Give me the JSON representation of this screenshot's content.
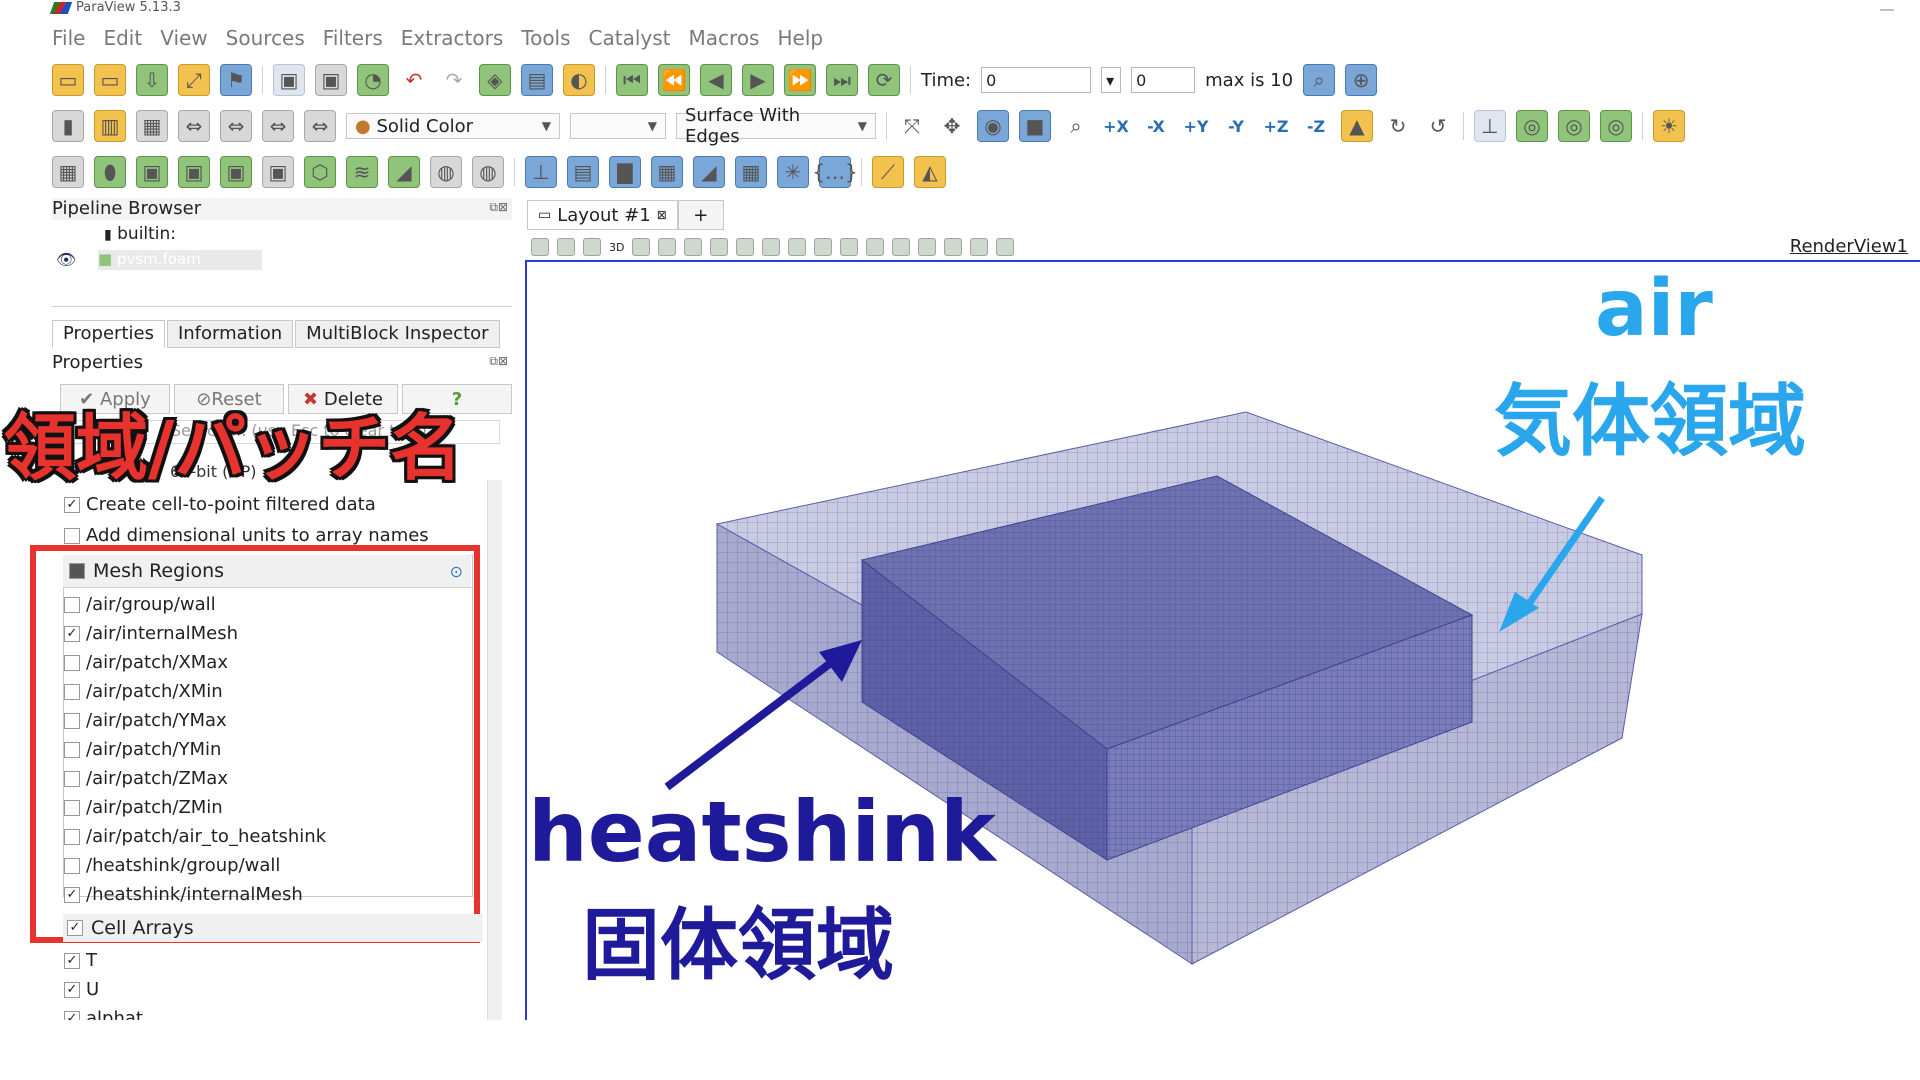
{
  "app": {
    "title": "ParaView 5.13.3",
    "minimize": "—"
  },
  "menu": [
    "File",
    "Edit",
    "View",
    "Sources",
    "Filters",
    "Extractors",
    "Tools",
    "Catalyst",
    "Macros",
    "Help"
  ],
  "toolbar_time": {
    "label": "Time:",
    "time_value": "0",
    "step_value": "0",
    "max_label": "max is 10"
  },
  "toolbar_display": {
    "color_by": "Solid Color",
    "component": "",
    "representation": "Surface With Edges"
  },
  "pipeline_browser": {
    "title": "Pipeline Browser",
    "builtin": "builtin:",
    "source_name": "pvsm.foam"
  },
  "panel_tabs": [
    "Properties",
    "Information",
    "MultiBlock Inspector"
  ],
  "properties": {
    "label": "Properties",
    "apply": "Apply",
    "reset": "Reset",
    "delete": "Delete",
    "help": "?",
    "search_placeholder": "Search ... (use Esc to clear text)",
    "row_64bit": "64-bit (DP)",
    "create_cell_to_point": "Create cell-to-point filtered data",
    "add_dimensional_units": "Add dimensional units to array names"
  },
  "mesh_regions": {
    "title": "Mesh Regions",
    "items": [
      {
        "label": "/air/group/wall",
        "checked": false
      },
      {
        "label": "/air/internalMesh",
        "checked": true
      },
      {
        "label": "/air/patch/XMax",
        "checked": false
      },
      {
        "label": "/air/patch/XMin",
        "checked": false
      },
      {
        "label": "/air/patch/YMax",
        "checked": false
      },
      {
        "label": "/air/patch/YMin",
        "checked": false
      },
      {
        "label": "/air/patch/ZMax",
        "checked": false
      },
      {
        "label": "/air/patch/ZMin",
        "checked": false
      },
      {
        "label": "/air/patch/air_to_heatshink",
        "checked": false
      },
      {
        "label": "/heatshink/group/wall",
        "checked": false
      },
      {
        "label": "/heatshink/internalMesh",
        "checked": true
      }
    ]
  },
  "cell_arrays": {
    "title": "Cell Arrays",
    "items": [
      {
        "label": "T",
        "checked": true
      },
      {
        "label": "U",
        "checked": true
      },
      {
        "label": "alphat",
        "checked": true
      }
    ]
  },
  "layout": {
    "tab": "Layout #1",
    "add": "+",
    "view_name": "RenderView1",
    "mode_3d": "3D"
  },
  "annotations": {
    "regions_patches": "領域/パッチ名",
    "air": "air",
    "air_jp": "気体領域",
    "heatshink": "heatshink",
    "heatshink_jp": "固体領域"
  },
  "colors": {
    "accent_red": "#e8322d",
    "air_blue": "#2aa7ec",
    "heat_navy": "#1f1a9a",
    "mesh": "#5a5ea8",
    "view_border": "#2a3bd6"
  }
}
